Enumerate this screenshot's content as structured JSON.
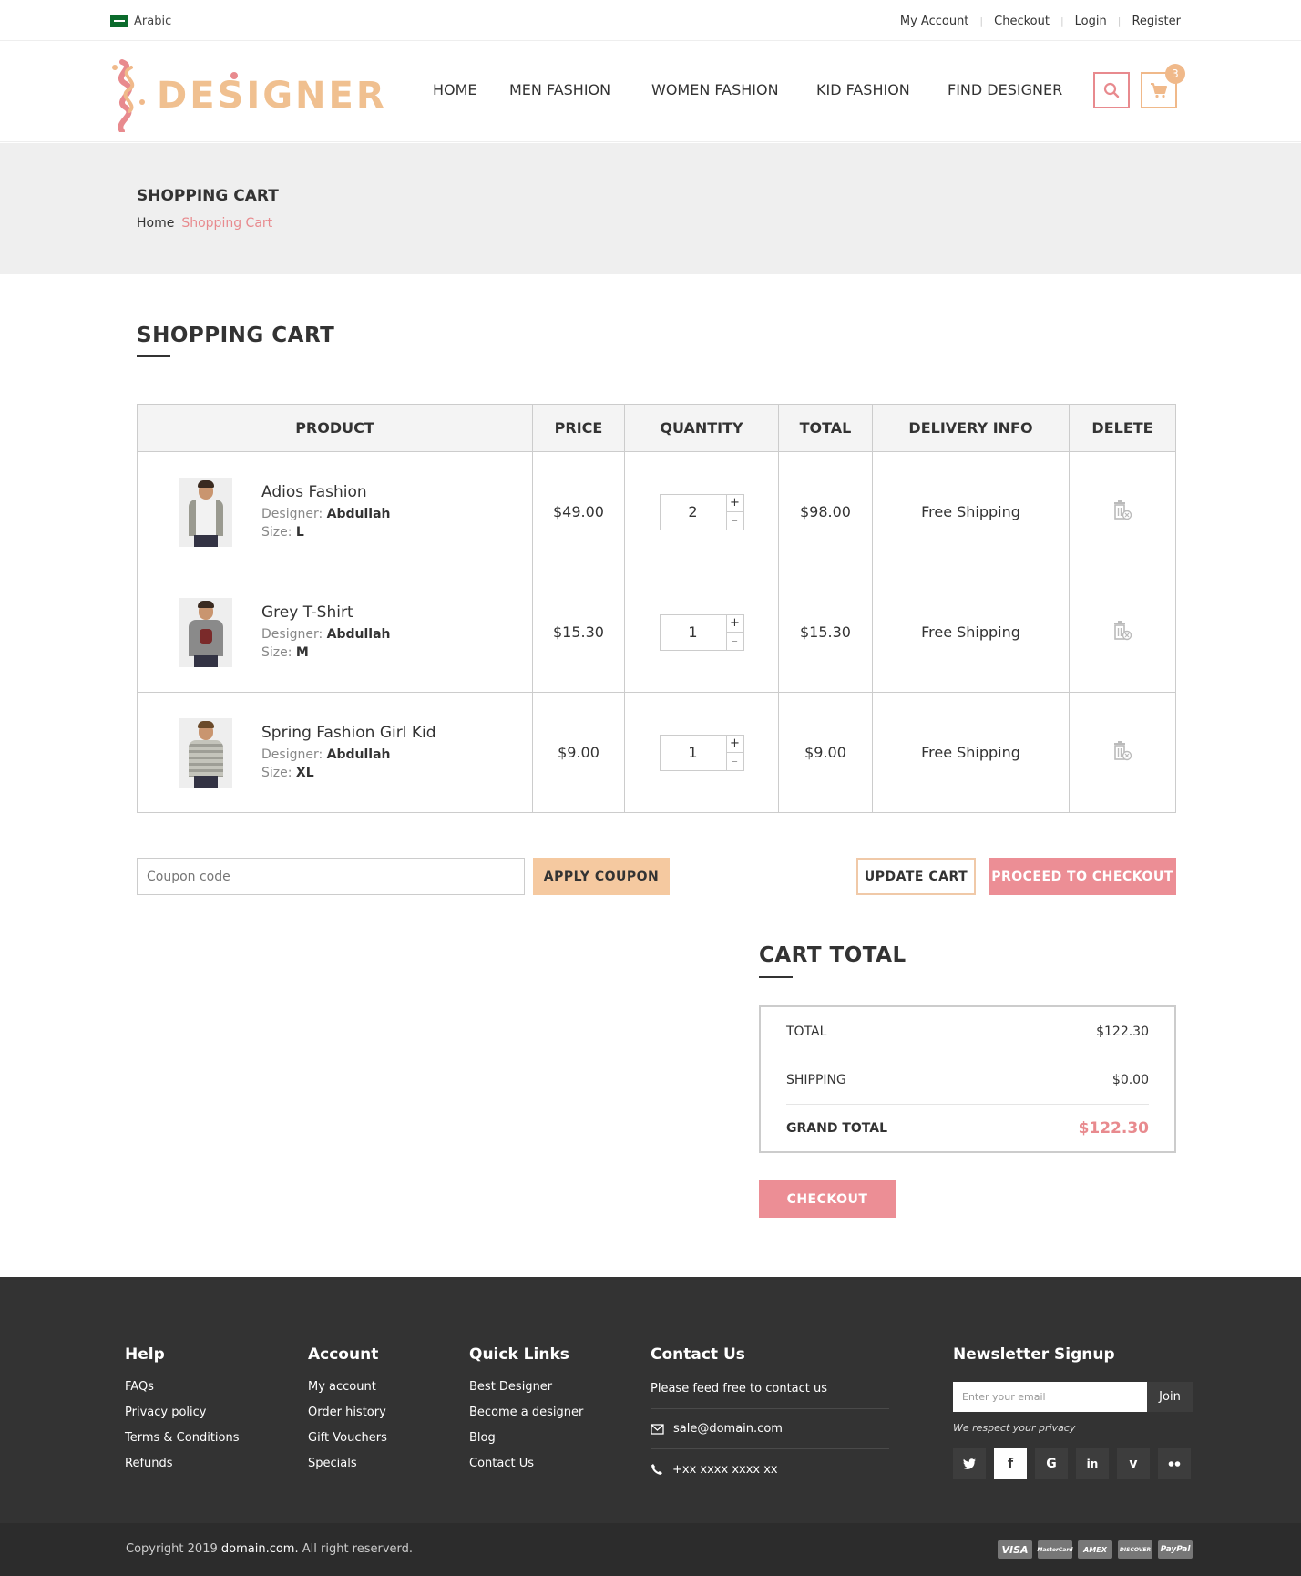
{
  "topbar": {
    "language": "Arabic",
    "links": [
      "My Account",
      "Checkout",
      "Login",
      "Register"
    ]
  },
  "header": {
    "logo_text": "DESIGNER",
    "nav": [
      "HOME",
      "MEN FASHION",
      "WOMEN FASHION",
      "KID FASHION",
      "FIND DESIGNER"
    ],
    "cart_count": "3",
    "icons": {
      "search": "search-icon",
      "cart": "cart-icon"
    },
    "colors": {
      "accent_pink": "#e88a8e",
      "accent_peach": "#f0b98a"
    }
  },
  "banner": {
    "title": "SHOPPING CART",
    "breadcrumb_home": "Home",
    "breadcrumb_current": "Shopping Cart"
  },
  "cart": {
    "heading": "SHOPPING CART",
    "columns": [
      "PRODUCT",
      "PRICE",
      "QUANTITY",
      "TOTAL",
      "DELIVERY INFO",
      "DELETE"
    ],
    "designer_label": "Designer:",
    "size_label": "Size:",
    "items": [
      {
        "name": "Adios Fashion",
        "designer": "Abdullah",
        "size": "L",
        "price": "$49.00",
        "quantity": "2",
        "total": "$98.00",
        "delivery": "Free Shipping",
        "shirt_color": "#f2f2f2"
      },
      {
        "name": "Grey T-Shirt",
        "designer": "Abdullah",
        "size": "M",
        "price": "$15.30",
        "quantity": "1",
        "total": "$15.30",
        "delivery": "Free Shipping",
        "shirt_color": "#8a8a8a"
      },
      {
        "name": "Spring Fashion Girl Kid",
        "designer": "Abdullah",
        "size": "XL",
        "price": "$9.00",
        "quantity": "1",
        "total": "$9.00",
        "delivery": "Free Shipping",
        "shirt_color": "#b9b9b0"
      }
    ],
    "qty_plus": "+",
    "qty_minus": "–",
    "coupon_placeholder": "Coupon code",
    "apply_coupon": "APPLY COUPON",
    "update_cart": "UPDATE CART",
    "proceed": "PROCEED TO CHECKOUT"
  },
  "cart_total": {
    "heading": "CART TOTAL",
    "total_label": "TOTAL",
    "total_value": "$122.30",
    "shipping_label": "SHIPPING",
    "shipping_value": "$0.00",
    "grand_label": "GRAND TOTAL",
    "grand_value": "$122.30",
    "checkout": "CHECKOUT"
  },
  "footer": {
    "help": {
      "title": "Help",
      "links": [
        "FAQs",
        "Privacy policy",
        "Terms & Conditions",
        "Refunds"
      ]
    },
    "account": {
      "title": "Account",
      "links": [
        "My account",
        "Order history",
        "Gift Vouchers",
        "Specials"
      ]
    },
    "quick": {
      "title": "Quick Links",
      "links": [
        "Best Designer",
        "Become a designer",
        "Blog",
        "Contact Us"
      ]
    },
    "contact": {
      "title": "Contact Us",
      "intro": "Please feed free to contact us",
      "email": "sale@domain.com",
      "phone": "+xx xxxx xxxx xx"
    },
    "newsletter": {
      "title": "Newsletter Signup",
      "placeholder": "Enter your email",
      "join": "Join",
      "privacy": "We respect your privacy"
    },
    "socials": [
      "twitter-icon",
      "facebook-icon",
      "google-plus-icon",
      "linkedin-icon",
      "vimeo-icon",
      "flickr-icon"
    ],
    "copyright_prefix": "Copyright 2019",
    "copyright_domain": "domain.com.",
    "copyright_suffix": "All right reserverd.",
    "payments": [
      "VISA",
      "MasterCard",
      "AMEX",
      "DISCOVER",
      "PayPal"
    ]
  }
}
